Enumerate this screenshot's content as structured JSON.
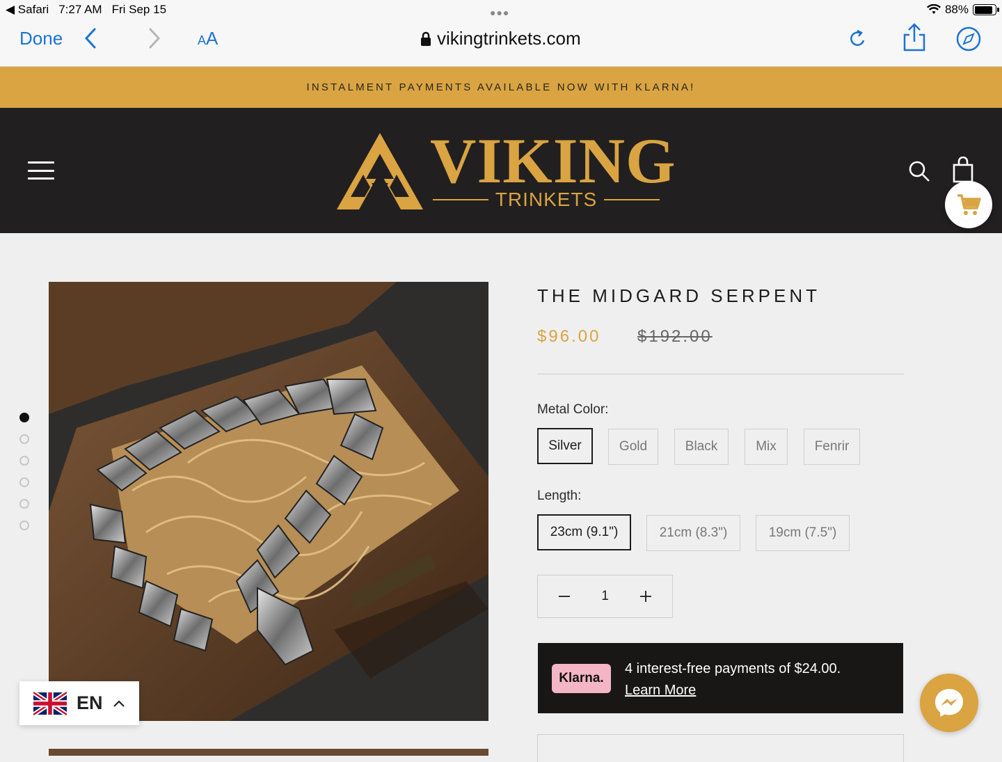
{
  "status_bar": {
    "back_app": "Safari",
    "time": "7:27 AM",
    "date": "Fri Sep 15",
    "battery": "88%"
  },
  "browser": {
    "done_label": "Done",
    "text_size_small": "A",
    "text_size_large": "A",
    "url": "vikingtrinkets.com"
  },
  "promo": {
    "text": "INSTALMENT PAYMENTS AVAILABLE NOW WITH KLARNA!"
  },
  "header": {
    "logo_word": "VIKING",
    "logo_sub": "TRINKETS"
  },
  "gallery": {
    "slide_count": 6,
    "active_index": 0
  },
  "product": {
    "title": "THE MIDGARD SERPENT",
    "price": "$96.00",
    "compare_price": "$192.00",
    "metal_label": "Metal Color:",
    "metal_options": [
      "Silver",
      "Gold",
      "Black",
      "Mix",
      "Fenrir"
    ],
    "metal_selected": "Silver",
    "length_label": "Length:",
    "length_options": [
      "23cm (9.1\")",
      "21cm (8.3\")",
      "19cm (7.5\")"
    ],
    "length_selected": "23cm (9.1\")",
    "quantity": "1"
  },
  "klarna": {
    "badge": "Klarna.",
    "message": "4 interest-free payments of $24.00.",
    "link": "Learn More"
  },
  "language": {
    "code": "EN"
  },
  "colors": {
    "brand_gold": "#d9a441",
    "header_bg": "#221f20",
    "ios_blue": "#1a73d6"
  }
}
